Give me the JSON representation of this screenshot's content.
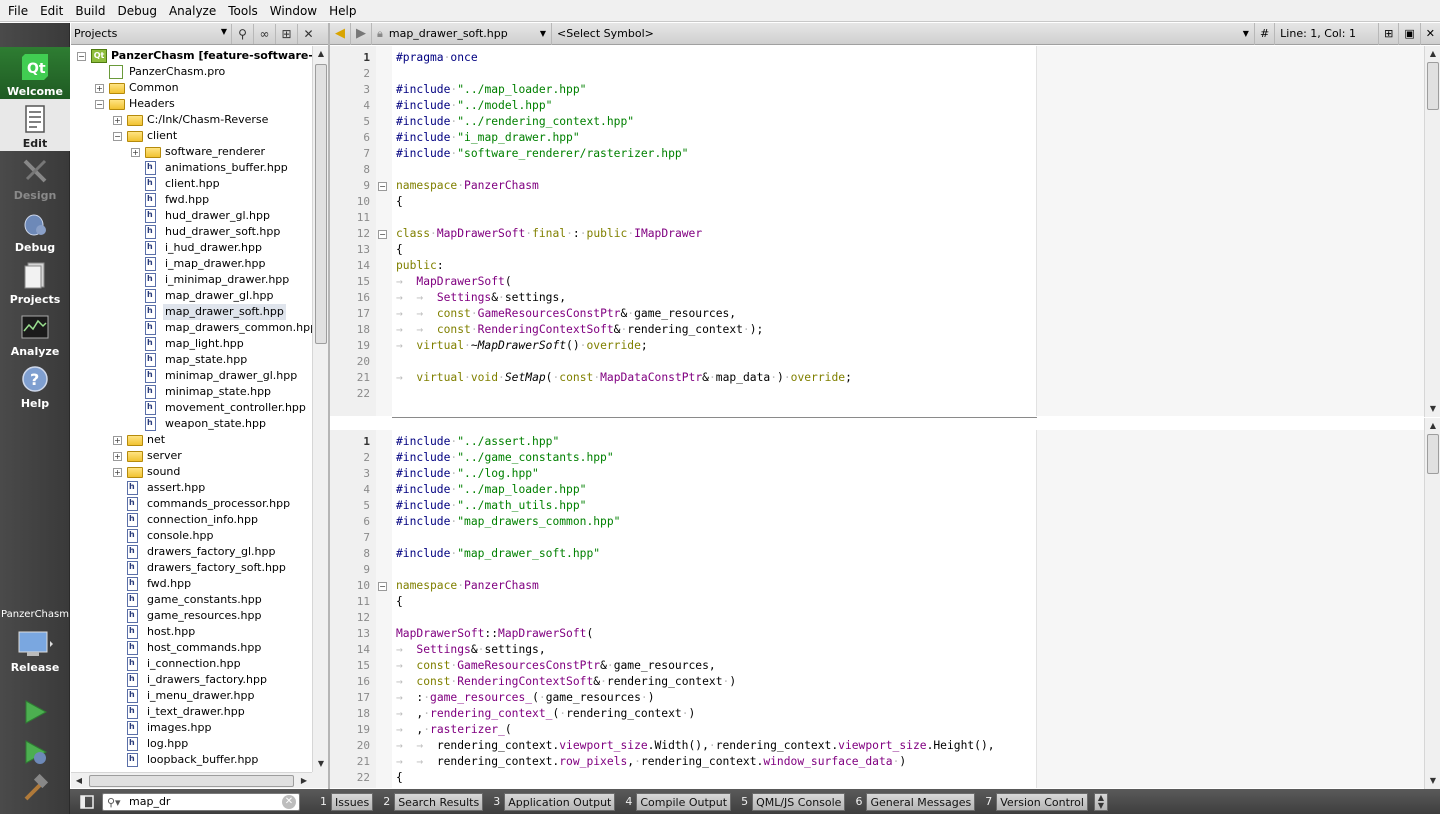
{
  "menus": [
    "File",
    "Edit",
    "Build",
    "Debug",
    "Analyze",
    "Tools",
    "Window",
    "Help"
  ],
  "modes": [
    {
      "label": "Welcome",
      "state": "dark-active"
    },
    {
      "label": "Edit",
      "state": "active"
    },
    {
      "label": "Design",
      "state": "disabled"
    },
    {
      "label": "Debug",
      "state": "normal"
    },
    {
      "label": "Projects",
      "state": "normal"
    },
    {
      "label": "Analyze",
      "state": "normal"
    },
    {
      "label": "Help",
      "state": "normal"
    }
  ],
  "kit": {
    "project": "PanzerChasm",
    "config": "Release"
  },
  "project_pane": {
    "combo": "Projects"
  },
  "tree": [
    {
      "d": 0,
      "type": "proj",
      "exp": "-",
      "label": "PanzerChasm [feature-software-re",
      "bold": true
    },
    {
      "d": 1,
      "type": "pro",
      "label": "PanzerChasm.pro"
    },
    {
      "d": 1,
      "type": "folder",
      "exp": "+",
      "label": "Common"
    },
    {
      "d": 1,
      "type": "folder",
      "exp": "-",
      "label": "Headers"
    },
    {
      "d": 2,
      "type": "folder",
      "exp": "+",
      "label": "C:/Ink/Chasm-Reverse"
    },
    {
      "d": 2,
      "type": "folder",
      "exp": "-",
      "label": "client"
    },
    {
      "d": 3,
      "type": "folder",
      "exp": "+",
      "label": "software_renderer"
    },
    {
      "d": 3,
      "type": "file",
      "label": "animations_buffer.hpp"
    },
    {
      "d": 3,
      "type": "file",
      "label": "client.hpp"
    },
    {
      "d": 3,
      "type": "file",
      "label": "fwd.hpp"
    },
    {
      "d": 3,
      "type": "file",
      "label": "hud_drawer_gl.hpp"
    },
    {
      "d": 3,
      "type": "file",
      "label": "hud_drawer_soft.hpp"
    },
    {
      "d": 3,
      "type": "file",
      "label": "i_hud_drawer.hpp"
    },
    {
      "d": 3,
      "type": "file",
      "label": "i_map_drawer.hpp"
    },
    {
      "d": 3,
      "type": "file",
      "label": "i_minimap_drawer.hpp"
    },
    {
      "d": 3,
      "type": "file",
      "label": "map_drawer_gl.hpp"
    },
    {
      "d": 3,
      "type": "file",
      "label": "map_drawer_soft.hpp",
      "sel": true
    },
    {
      "d": 3,
      "type": "file",
      "label": "map_drawers_common.hpp"
    },
    {
      "d": 3,
      "type": "file",
      "label": "map_light.hpp"
    },
    {
      "d": 3,
      "type": "file",
      "label": "map_state.hpp"
    },
    {
      "d": 3,
      "type": "file",
      "label": "minimap_drawer_gl.hpp"
    },
    {
      "d": 3,
      "type": "file",
      "label": "minimap_state.hpp"
    },
    {
      "d": 3,
      "type": "file",
      "label": "movement_controller.hpp"
    },
    {
      "d": 3,
      "type": "file",
      "label": "weapon_state.hpp"
    },
    {
      "d": 2,
      "type": "folder",
      "exp": "+",
      "label": "net"
    },
    {
      "d": 2,
      "type": "folder",
      "exp": "+",
      "label": "server"
    },
    {
      "d": 2,
      "type": "folder",
      "exp": "+",
      "label": "sound"
    },
    {
      "d": 2,
      "type": "file",
      "label": "assert.hpp"
    },
    {
      "d": 2,
      "type": "file",
      "label": "commands_processor.hpp"
    },
    {
      "d": 2,
      "type": "file",
      "label": "connection_info.hpp"
    },
    {
      "d": 2,
      "type": "file",
      "label": "console.hpp"
    },
    {
      "d": 2,
      "type": "file",
      "label": "drawers_factory_gl.hpp"
    },
    {
      "d": 2,
      "type": "file",
      "label": "drawers_factory_soft.hpp"
    },
    {
      "d": 2,
      "type": "file",
      "label": "fwd.hpp"
    },
    {
      "d": 2,
      "type": "file",
      "label": "game_constants.hpp"
    },
    {
      "d": 2,
      "type": "file",
      "label": "game_resources.hpp"
    },
    {
      "d": 2,
      "type": "file",
      "label": "host.hpp"
    },
    {
      "d": 2,
      "type": "file",
      "label": "host_commands.hpp"
    },
    {
      "d": 2,
      "type": "file",
      "label": "i_connection.hpp"
    },
    {
      "d": 2,
      "type": "file",
      "label": "i_drawers_factory.hpp"
    },
    {
      "d": 2,
      "type": "file",
      "label": "i_menu_drawer.hpp"
    },
    {
      "d": 2,
      "type": "file",
      "label": "i_text_drawer.hpp"
    },
    {
      "d": 2,
      "type": "file",
      "label": "images.hpp"
    },
    {
      "d": 2,
      "type": "file",
      "label": "log.hpp"
    },
    {
      "d": 2,
      "type": "file",
      "label": "loopback_buffer.hpp"
    }
  ],
  "editor_toolbar": {
    "file": "map_drawer_soft.hpp",
    "symbol": "<Select Symbol>",
    "hash": "#",
    "position": "Line: 1, Col: 1"
  },
  "editor1": [
    {
      "n": "1",
      "c": [
        [
          "p",
          "#pragma"
        ],
        [
          "w",
          "·"
        ],
        [
          "p",
          "once"
        ]
      ]
    },
    {
      "n": "2",
      "c": []
    },
    {
      "n": "3",
      "c": [
        [
          "p",
          "#include"
        ],
        [
          "w",
          "·"
        ],
        [
          "s",
          "\"../map_loader.hpp\""
        ]
      ]
    },
    {
      "n": "4",
      "c": [
        [
          "p",
          "#include"
        ],
        [
          "w",
          "·"
        ],
        [
          "s",
          "\"../model.hpp\""
        ]
      ]
    },
    {
      "n": "5",
      "c": [
        [
          "p",
          "#include"
        ],
        [
          "w",
          "·"
        ],
        [
          "s",
          "\"../rendering_context.hpp\""
        ]
      ]
    },
    {
      "n": "6",
      "c": [
        [
          "p",
          "#include"
        ],
        [
          "w",
          "·"
        ],
        [
          "s",
          "\"i_map_drawer.hpp\""
        ]
      ]
    },
    {
      "n": "7",
      "c": [
        [
          "p",
          "#include"
        ],
        [
          "w",
          "·"
        ],
        [
          "s",
          "\"software_renderer/rasterizer.hpp\""
        ]
      ]
    },
    {
      "n": "8",
      "c": []
    },
    {
      "n": "9",
      "fold": true,
      "c": [
        [
          "k",
          "namespace"
        ],
        [
          "w",
          "·"
        ],
        [
          "t",
          "PanzerChasm"
        ]
      ]
    },
    {
      "n": "10",
      "c": [
        [
          "",
          "{"
        ]
      ]
    },
    {
      "n": "11",
      "c": []
    },
    {
      "n": "12",
      "fold": true,
      "c": [
        [
          "k",
          "class"
        ],
        [
          "w",
          "·"
        ],
        [
          "t",
          "MapDrawerSoft"
        ],
        [
          "w",
          "·"
        ],
        [
          "k",
          "final"
        ],
        [
          "w",
          "·"
        ],
        [
          "",
          ":"
        ],
        [
          "w",
          "·"
        ],
        [
          "k",
          "public"
        ],
        [
          "w",
          "·"
        ],
        [
          "t",
          "IMapDrawer"
        ]
      ]
    },
    {
      "n": "13",
      "c": [
        [
          "",
          "{"
        ]
      ]
    },
    {
      "n": "14",
      "c": [
        [
          "k",
          "public"
        ],
        [
          "",
          ":"
        ]
      ]
    },
    {
      "n": "15",
      "c": [
        [
          "w",
          "→  "
        ],
        [
          "t",
          "MapDrawerSoft"
        ],
        [
          "",
          "("
        ]
      ]
    },
    {
      "n": "16",
      "c": [
        [
          "w",
          "→  →  "
        ],
        [
          "t",
          "Settings"
        ],
        [
          "",
          "&"
        ],
        [
          "w",
          "·"
        ],
        [
          "",
          "settings,"
        ]
      ]
    },
    {
      "n": "17",
      "c": [
        [
          "w",
          "→  →  "
        ],
        [
          "k",
          "const"
        ],
        [
          "w",
          "·"
        ],
        [
          "t",
          "GameResourcesConstPtr"
        ],
        [
          "",
          "&"
        ],
        [
          "w",
          "·"
        ],
        [
          "",
          "game_resources,"
        ]
      ]
    },
    {
      "n": "18",
      "c": [
        [
          "w",
          "→  →  "
        ],
        [
          "k",
          "const"
        ],
        [
          "w",
          "·"
        ],
        [
          "t",
          "RenderingContextSoft"
        ],
        [
          "",
          "&"
        ],
        [
          "w",
          "·"
        ],
        [
          "",
          "rendering_context"
        ],
        [
          "w",
          "·"
        ],
        [
          "",
          ");"
        ]
      ]
    },
    {
      "n": "19",
      "c": [
        [
          "w",
          "→  "
        ],
        [
          "k",
          "virtual"
        ],
        [
          "w",
          "·"
        ],
        [
          "i",
          "~MapDrawerSoft"
        ],
        [
          "",
          "()"
        ],
        [
          "w",
          "·"
        ],
        [
          "k",
          "override"
        ],
        [
          "",
          ";"
        ]
      ]
    },
    {
      "n": "20",
      "c": []
    },
    {
      "n": "21",
      "c": [
        [
          "w",
          "→  "
        ],
        [
          "k",
          "virtual"
        ],
        [
          "w",
          "·"
        ],
        [
          "k",
          "void"
        ],
        [
          "w",
          "·"
        ],
        [
          "i",
          "SetMap"
        ],
        [
          "",
          "("
        ],
        [
          "w",
          "·"
        ],
        [
          "k",
          "const"
        ],
        [
          "w",
          "·"
        ],
        [
          "t",
          "MapDataConstPtr"
        ],
        [
          "",
          "&"
        ],
        [
          "w",
          "·"
        ],
        [
          "",
          "map_data"
        ],
        [
          "w",
          "·"
        ],
        [
          "",
          ")"
        ],
        [
          "w",
          "·"
        ],
        [
          "k",
          "override"
        ],
        [
          "",
          ";"
        ]
      ]
    },
    {
      "n": "22",
      "c": []
    }
  ],
  "editor2": [
    {
      "n": "1",
      "c": [
        [
          "p",
          "#include"
        ],
        [
          "w",
          "·"
        ],
        [
          "s",
          "\"../assert.hpp\""
        ]
      ]
    },
    {
      "n": "2",
      "c": [
        [
          "p",
          "#include"
        ],
        [
          "w",
          "·"
        ],
        [
          "s",
          "\"../game_constants.hpp\""
        ]
      ]
    },
    {
      "n": "3",
      "c": [
        [
          "p",
          "#include"
        ],
        [
          "w",
          "·"
        ],
        [
          "s",
          "\"../log.hpp\""
        ]
      ]
    },
    {
      "n": "4",
      "c": [
        [
          "p",
          "#include"
        ],
        [
          "w",
          "·"
        ],
        [
          "s",
          "\"../map_loader.hpp\""
        ]
      ]
    },
    {
      "n": "5",
      "c": [
        [
          "p",
          "#include"
        ],
        [
          "w",
          "·"
        ],
        [
          "s",
          "\"../math_utils.hpp\""
        ]
      ]
    },
    {
      "n": "6",
      "c": [
        [
          "p",
          "#include"
        ],
        [
          "w",
          "·"
        ],
        [
          "s",
          "\"map_drawers_common.hpp\""
        ]
      ]
    },
    {
      "n": "7",
      "c": []
    },
    {
      "n": "8",
      "c": [
        [
          "p",
          "#include"
        ],
        [
          "w",
          "·"
        ],
        [
          "s",
          "\"map_drawer_soft.hpp\""
        ]
      ]
    },
    {
      "n": "9",
      "c": []
    },
    {
      "n": "10",
      "fold": true,
      "c": [
        [
          "k",
          "namespace"
        ],
        [
          "w",
          "·"
        ],
        [
          "t",
          "PanzerChasm"
        ]
      ]
    },
    {
      "n": "11",
      "c": [
        [
          "",
          "{"
        ]
      ]
    },
    {
      "n": "12",
      "c": []
    },
    {
      "n": "13",
      "c": [
        [
          "t",
          "MapDrawerSoft"
        ],
        [
          "",
          "::"
        ],
        [
          "t",
          "MapDrawerSoft"
        ],
        [
          "",
          "("
        ]
      ]
    },
    {
      "n": "14",
      "c": [
        [
          "w",
          "→  "
        ],
        [
          "t",
          "Settings"
        ],
        [
          "",
          "&"
        ],
        [
          "w",
          "·"
        ],
        [
          "",
          "settings,"
        ]
      ]
    },
    {
      "n": "15",
      "c": [
        [
          "w",
          "→  "
        ],
        [
          "k",
          "const"
        ],
        [
          "w",
          "·"
        ],
        [
          "t",
          "GameResourcesConstPtr"
        ],
        [
          "",
          "&"
        ],
        [
          "w",
          "·"
        ],
        [
          "",
          "game_resources,"
        ]
      ]
    },
    {
      "n": "16",
      "c": [
        [
          "w",
          "→  "
        ],
        [
          "k",
          "const"
        ],
        [
          "w",
          "·"
        ],
        [
          "t",
          "RenderingContextSoft"
        ],
        [
          "",
          "&"
        ],
        [
          "w",
          "·"
        ],
        [
          "",
          "rendering_context"
        ],
        [
          "w",
          "·"
        ],
        [
          "",
          ")"
        ]
      ]
    },
    {
      "n": "17",
      "c": [
        [
          "w",
          "→  "
        ],
        [
          "",
          ":"
        ],
        [
          "w",
          "·"
        ],
        [
          "t",
          "game_resources_"
        ],
        [
          "",
          "("
        ],
        [
          "w",
          "·"
        ],
        [
          "",
          "game_resources"
        ],
        [
          "w",
          "·"
        ],
        [
          "",
          ")"
        ]
      ]
    },
    {
      "n": "18",
      "c": [
        [
          "w",
          "→  "
        ],
        [
          "",
          ","
        ],
        [
          "w",
          "·"
        ],
        [
          "t",
          "rendering_context_"
        ],
        [
          "",
          "("
        ],
        [
          "w",
          "·"
        ],
        [
          "",
          "rendering_context"
        ],
        [
          "w",
          "·"
        ],
        [
          "",
          ")"
        ]
      ]
    },
    {
      "n": "19",
      "c": [
        [
          "w",
          "→  "
        ],
        [
          "",
          ","
        ],
        [
          "w",
          "·"
        ],
        [
          "t",
          "rasterizer_"
        ],
        [
          "",
          "("
        ]
      ]
    },
    {
      "n": "20",
      "c": [
        [
          "w",
          "→  →  "
        ],
        [
          "",
          "rendering_context."
        ],
        [
          "t",
          "viewport_size"
        ],
        [
          "",
          ".Width(),"
        ],
        [
          "w",
          "·"
        ],
        [
          "",
          "rendering_context."
        ],
        [
          "t",
          "viewport_size"
        ],
        [
          "",
          ".Height(),"
        ]
      ]
    },
    {
      "n": "21",
      "c": [
        [
          "w",
          "→  →  "
        ],
        [
          "",
          "rendering_context."
        ],
        [
          "t",
          "row_pixels"
        ],
        [
          "",
          ","
        ],
        [
          "w",
          "·"
        ],
        [
          "",
          "rendering_context."
        ],
        [
          "t",
          "window_surface_data"
        ],
        [
          "w",
          "·"
        ],
        [
          "",
          ")"
        ]
      ]
    },
    {
      "n": "22",
      "c": [
        [
          "",
          "{"
        ]
      ]
    }
  ],
  "status": {
    "locator_text": "map_dr",
    "panes": [
      {
        "num": "1",
        "label": "Issues"
      },
      {
        "num": "2",
        "label": "Search Results"
      },
      {
        "num": "3",
        "label": "Application Output"
      },
      {
        "num": "4",
        "label": "Compile Output"
      },
      {
        "num": "5",
        "label": "QML/JS Console"
      },
      {
        "num": "6",
        "label": "General Messages"
      },
      {
        "num": "7",
        "label": "Version Control"
      }
    ]
  },
  "colors": {
    "keyword": "#808000",
    "string": "#008000",
    "type": "#800080",
    "preprocessor": "#000080",
    "whitespace": "#bdbdbd"
  }
}
